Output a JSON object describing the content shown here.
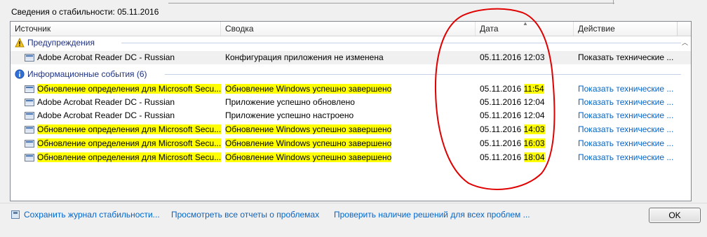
{
  "window": {
    "title": "Сведения о стабильности: 05.11.2016"
  },
  "columns": [
    {
      "label": "Источник"
    },
    {
      "label": "Сводка"
    },
    {
      "label": "Дата"
    },
    {
      "label": "Действие"
    }
  ],
  "groups": {
    "warnings": {
      "label": "Предупреждения",
      "icon": "warning-icon",
      "rows": [
        {
          "source": "Adobe Acrobat Reader DC - Russian",
          "summary": "Конфигурация приложения не изменена",
          "date": "05.11.2016",
          "time": "12:03",
          "action": "Показать технические ...",
          "highlight": false
        }
      ]
    },
    "info": {
      "label": "Информационные события (6)",
      "icon": "info-icon",
      "rows": [
        {
          "source": "Обновление определения для Microsoft Secu...",
          "summary": "Обновление Windows успешно завершено",
          "date": "05.11.2016",
          "time": "11:54",
          "action": "Показать технические ...",
          "highlight": true
        },
        {
          "source": "Adobe Acrobat Reader DC - Russian",
          "summary": "Приложение успешно обновлено",
          "date": "05.11.2016",
          "time": "12:04",
          "action": "Показать технические ...",
          "highlight": false
        },
        {
          "source": "Adobe Acrobat Reader DC - Russian",
          "summary": "Приложение успешно настроено",
          "date": "05.11.2016",
          "time": "12:04",
          "action": "Показать технические ...",
          "highlight": false
        },
        {
          "source": "Обновление определения для Microsoft Secu...",
          "summary": "Обновление Windows успешно завершено",
          "date": "05.11.2016",
          "time": "14:03",
          "action": "Показать технические ...",
          "highlight": true
        },
        {
          "source": "Обновление определения для Microsoft Secu...",
          "summary": "Обновление Windows успешно завершено",
          "date": "05.11.2016",
          "time": "16:03",
          "action": "Показать технические ...",
          "highlight": true
        },
        {
          "source": "Обновление определения для Microsoft Secu...",
          "summary": "Обновление Windows успешно завершено",
          "date": "05.11.2016",
          "time": "18:04",
          "action": "Показать технические ...",
          "highlight": true
        }
      ]
    }
  },
  "footer": {
    "save_label": "Сохранить журнал стабильности...",
    "view_all_label": "Просмотреть все отчеты о проблемах",
    "check_solutions_label": "Проверить наличие решений для всех проблем ...",
    "ok_label": "OK"
  },
  "colors": {
    "link": "#0066cc",
    "group_header": "#1e3287",
    "highlight": "#ffff00",
    "annotation": "#e00000"
  }
}
